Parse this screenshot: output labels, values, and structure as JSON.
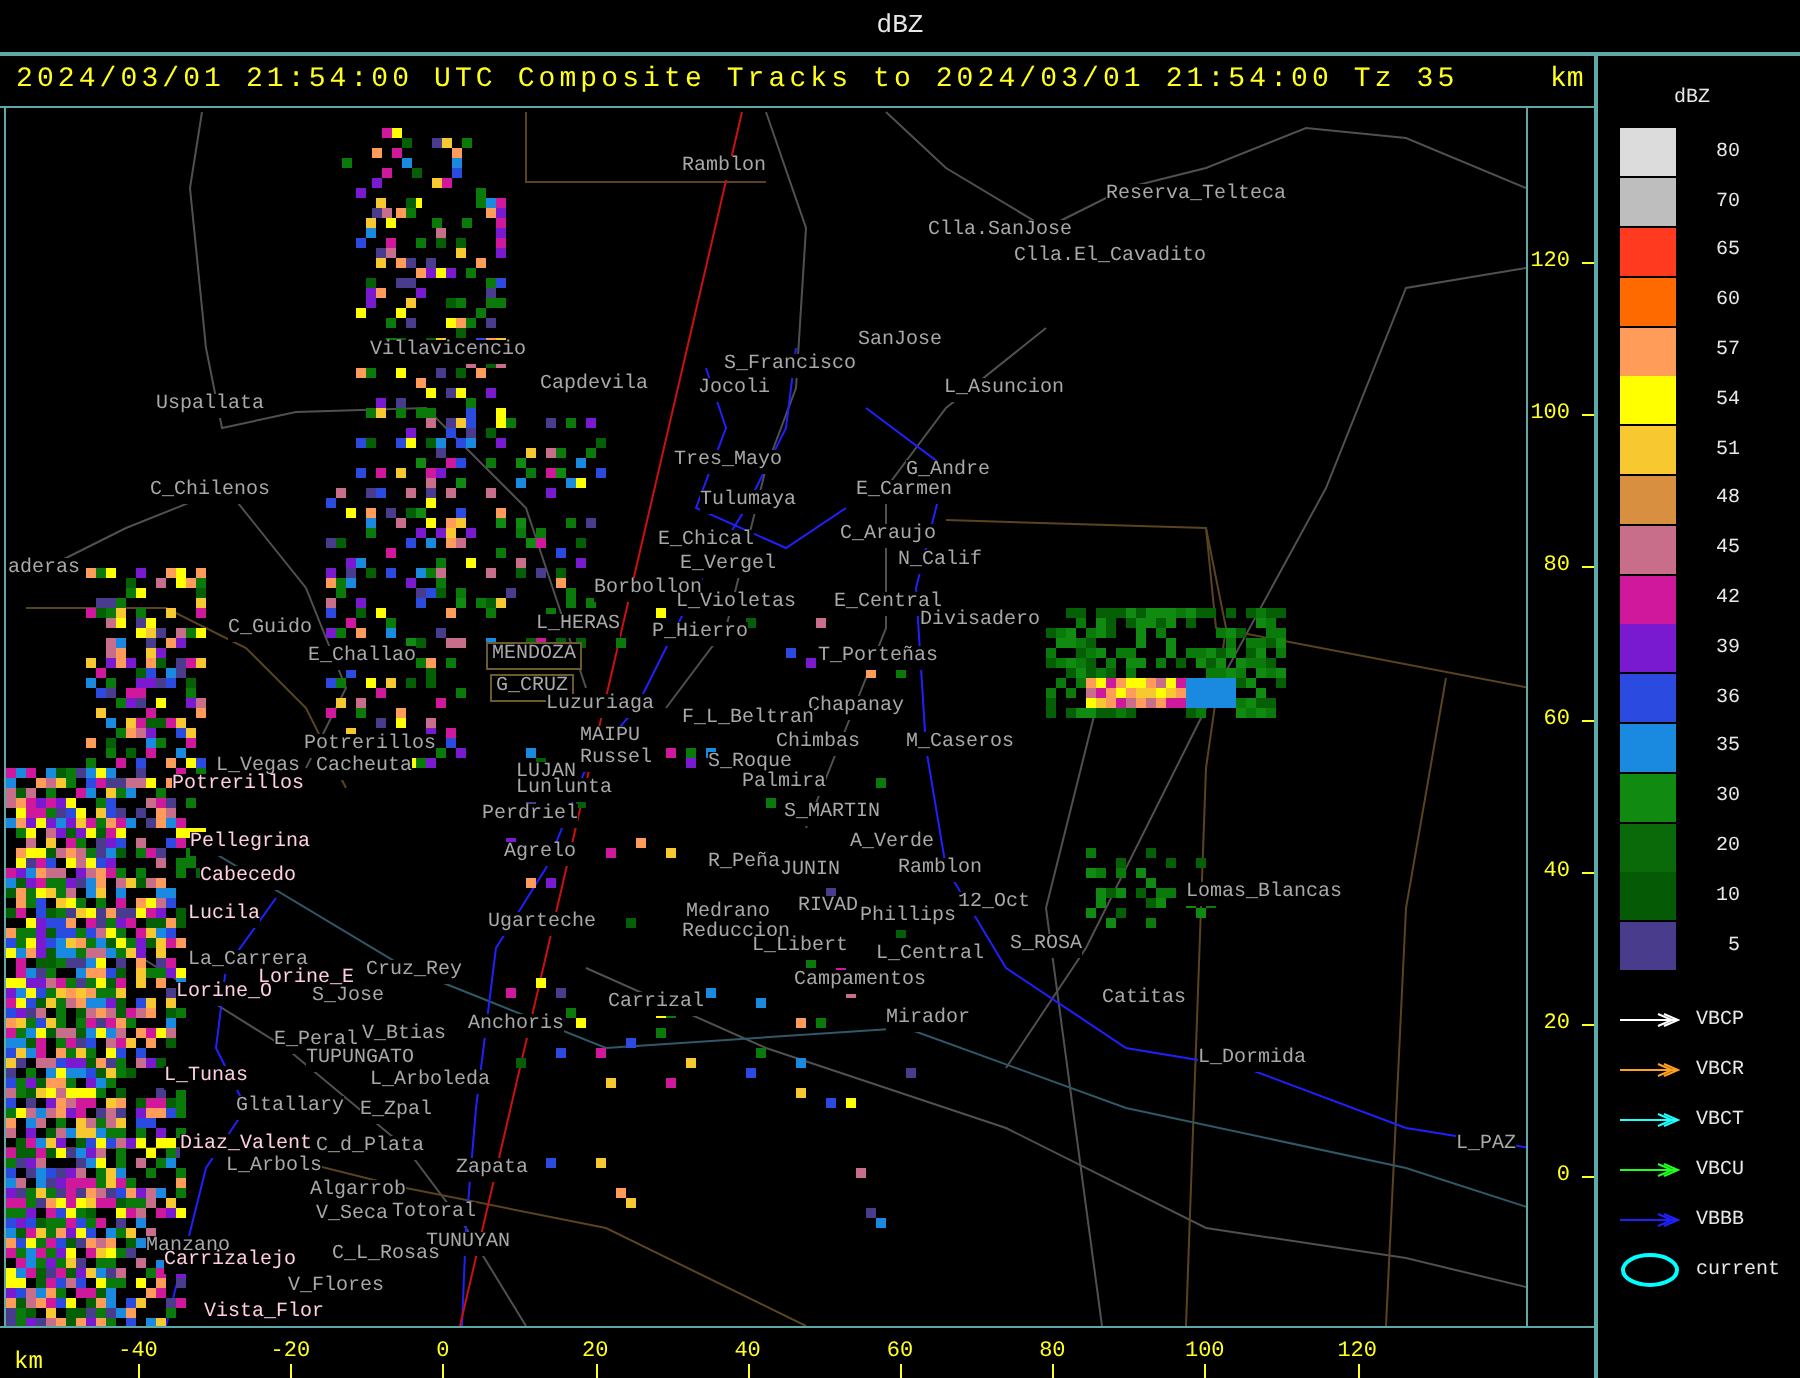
{
  "title_bar": {
    "title": "dBZ"
  },
  "header": {
    "caption": "2024/03/01 21:54:00 UTC Composite Tracks to 2024/03/01 21:54:00 Tz 35",
    "unit": "km"
  },
  "map": {
    "places": [
      {
        "name": "Ramblon",
        "color": "#a8a8a8",
        "kind": "plain"
      },
      {
        "name": "Reserva_Telteca",
        "color": "#a8a8a8",
        "kind": "plain"
      },
      {
        "name": "Clla.SanJose",
        "color": "#a8a8a8",
        "kind": "plain"
      },
      {
        "name": "Clla.El_Cavadito",
        "color": "#a8a8a8",
        "kind": "plain"
      },
      {
        "name": "SanJose",
        "color": "#a8a8a8",
        "kind": "plain"
      },
      {
        "name": "Villavicencio",
        "color": "#a8a8a8",
        "kind": "plain"
      },
      {
        "name": "S_Francisco",
        "color": "#a8a8a8",
        "kind": "plain"
      },
      {
        "name": "Capdevila",
        "color": "#a8a8a8",
        "kind": "plain"
      },
      {
        "name": "Jocoli",
        "color": "#a8a8a8",
        "kind": "plain"
      },
      {
        "name": "L_Asuncion",
        "color": "#a8a8a8",
        "kind": "plain"
      },
      {
        "name": "Uspallata",
        "color": "#a8a8a8",
        "kind": "plain"
      },
      {
        "name": "Tres_Mayo",
        "color": "#a8a8a8",
        "kind": "plain"
      },
      {
        "name": "G_Andre",
        "color": "#a8a8a8",
        "kind": "plain"
      },
      {
        "name": "C_Chilenos",
        "color": "#a8a8a8",
        "kind": "plain"
      },
      {
        "name": "E_Carmen",
        "color": "#a8a8a8",
        "kind": "plain"
      },
      {
        "name": "Tulumaya",
        "color": "#a8a8a8",
        "kind": "plain"
      },
      {
        "name": "E_Chical",
        "color": "#a8a8a8",
        "kind": "plain"
      },
      {
        "name": "C_Araujo",
        "color": "#a8a8a8",
        "kind": "plain"
      },
      {
        "name": "E_Vergel",
        "color": "#a8a8a8",
        "kind": "plain"
      },
      {
        "name": "N_Calif",
        "color": "#a8a8a8",
        "kind": "plain"
      },
      {
        "name": "aderas",
        "color": "#a8a8a8",
        "kind": "plain"
      },
      {
        "name": "Borbollon",
        "color": "#a8a8a8",
        "kind": "plain"
      },
      {
        "name": "L_Violetas",
        "color": "#a8a8a8",
        "kind": "plain"
      },
      {
        "name": "E_Central",
        "color": "#a8a8a8",
        "kind": "plain"
      },
      {
        "name": "C_Guido",
        "color": "#a8a8a8",
        "kind": "plain"
      },
      {
        "name": "L_HERAS",
        "color": "#a8a8a8",
        "kind": "plain"
      },
      {
        "name": "P_Hierro",
        "color": "#a8a8a8",
        "kind": "plain"
      },
      {
        "name": "Divisadero",
        "color": "#a8a8a8",
        "kind": "plain"
      },
      {
        "name": "E_Challao",
        "color": "#a8a8a8",
        "kind": "plain"
      },
      {
        "name": "MENDOZA",
        "color": "#a8a8a8",
        "kind": "boxed"
      },
      {
        "name": "T_Porteñas",
        "color": "#a8a8a8",
        "kind": "plain"
      },
      {
        "name": "G_CRUZ",
        "color": "#a8a8a8",
        "kind": "boxed"
      },
      {
        "name": "Luzuriaga",
        "color": "#a8a8a8",
        "kind": "plain"
      },
      {
        "name": "Chapanay",
        "color": "#a8a8a8",
        "kind": "plain"
      },
      {
        "name": "F_L_Beltran",
        "color": "#a8a8a8",
        "kind": "plain"
      },
      {
        "name": "Potrerillos",
        "color": "#a8a8a8",
        "kind": "plain"
      },
      {
        "name": "MAIPU",
        "color": "#a8a8a8",
        "kind": "plain"
      },
      {
        "name": "Chimbas",
        "color": "#a8a8a8",
        "kind": "plain"
      },
      {
        "name": "M_Caseros",
        "color": "#a8a8a8",
        "kind": "plain"
      },
      {
        "name": "L_Vegas",
        "color": "#a8a8a8",
        "kind": "plain"
      },
      {
        "name": "Cacheuta",
        "color": "#a8a8a8",
        "kind": "plain"
      },
      {
        "name": "Russel",
        "color": "#a8a8a8",
        "kind": "plain"
      },
      {
        "name": "S_Roque",
        "color": "#a8a8a8",
        "kind": "plain"
      },
      {
        "name": "LUJAN",
        "color": "#a8a8a8",
        "kind": "plain"
      },
      {
        "name": "Potrerillos",
        "color": "#ffd0e0",
        "kind": "plain"
      },
      {
        "name": "Lunlunta",
        "color": "#a8a8a8",
        "kind": "plain"
      },
      {
        "name": "Palmira",
        "color": "#a8a8a8",
        "kind": "plain"
      },
      {
        "name": "Perdriel",
        "color": "#a8a8a8",
        "kind": "plain"
      },
      {
        "name": "S_MARTIN",
        "color": "#a8a8a8",
        "kind": "plain"
      },
      {
        "name": "Pellegrina",
        "color": "#ffd0e0",
        "kind": "plain"
      },
      {
        "name": "A_Verde",
        "color": "#a8a8a8",
        "kind": "plain"
      },
      {
        "name": "Agrelo",
        "color": "#a8a8a8",
        "kind": "plain"
      },
      {
        "name": "Cabecedo",
        "color": "#ffd0e0",
        "kind": "plain"
      },
      {
        "name": "R_Peña",
        "color": "#a8a8a8",
        "kind": "plain"
      },
      {
        "name": "JUNIN",
        "color": "#a8a8a8",
        "kind": "plain"
      },
      {
        "name": "Ramblon",
        "color": "#a8a8a8",
        "kind": "plain"
      },
      {
        "name": "Lomas_Blancas",
        "color": "#a8a8a8",
        "kind": "plain"
      },
      {
        "name": "Lucila",
        "color": "#ffd0e0",
        "kind": "plain"
      },
      {
        "name": "RIVAD",
        "color": "#a8a8a8",
        "kind": "plain"
      },
      {
        "name": "12_Oct",
        "color": "#a8a8a8",
        "kind": "plain"
      },
      {
        "name": "Medrano",
        "color": "#a8a8a8",
        "kind": "plain"
      },
      {
        "name": "Ugarteche",
        "color": "#a8a8a8",
        "kind": "plain"
      },
      {
        "name": "Phillips",
        "color": "#a8a8a8",
        "kind": "plain"
      },
      {
        "name": "Reduccion",
        "color": "#a8a8a8",
        "kind": "plain"
      },
      {
        "name": "L_Libert",
        "color": "#a8a8a8",
        "kind": "plain"
      },
      {
        "name": "S_ROSA",
        "color": "#a8a8a8",
        "kind": "plain"
      },
      {
        "name": "La_Carrera",
        "color": "#a8a8a8",
        "kind": "plain"
      },
      {
        "name": "L_Central",
        "color": "#a8a8a8",
        "kind": "plain"
      },
      {
        "name": "Cruz_Rey",
        "color": "#a8a8a8",
        "kind": "plain"
      },
      {
        "name": "Lorine_E",
        "color": "#ffd0e0",
        "kind": "plain"
      },
      {
        "name": "Campamentos",
        "color": "#a8a8a8",
        "kind": "plain"
      },
      {
        "name": "Lorine_O",
        "color": "#ffd0e0",
        "kind": "plain"
      },
      {
        "name": "S_Jose",
        "color": "#a8a8a8",
        "kind": "plain"
      },
      {
        "name": "Carrizal",
        "color": "#a8a8a8",
        "kind": "plain"
      },
      {
        "name": "Catitas",
        "color": "#a8a8a8",
        "kind": "plain"
      },
      {
        "name": "Anchoris",
        "color": "#a8a8a8",
        "kind": "plain"
      },
      {
        "name": "Mirador",
        "color": "#a8a8a8",
        "kind": "plain"
      },
      {
        "name": "E_Peral",
        "color": "#a8a8a8",
        "kind": "plain"
      },
      {
        "name": "V_Btias",
        "color": "#a8a8a8",
        "kind": "plain"
      },
      {
        "name": "TUPUNGATO",
        "color": "#a8a8a8",
        "kind": "plain"
      },
      {
        "name": "L_Dormida",
        "color": "#a8a8a8",
        "kind": "plain"
      },
      {
        "name": "L_Tunas",
        "color": "#ffd0e0",
        "kind": "plain"
      },
      {
        "name": "L_Arboleda",
        "color": "#a8a8a8",
        "kind": "plain"
      },
      {
        "name": "Gltallary",
        "color": "#a8a8a8",
        "kind": "plain"
      },
      {
        "name": "E_Zpal",
        "color": "#a8a8a8",
        "kind": "plain"
      },
      {
        "name": "Diaz_Valent",
        "color": "#ffd0e0",
        "kind": "plain"
      },
      {
        "name": "C_d_Plata",
        "color": "#a8a8a8",
        "kind": "plain"
      },
      {
        "name": "L_PAZ",
        "color": "#a8a8a8",
        "kind": "plain"
      },
      {
        "name": "L_Arbols",
        "color": "#a8a8a8",
        "kind": "plain"
      },
      {
        "name": "Zapata",
        "color": "#a8a8a8",
        "kind": "plain"
      },
      {
        "name": "Algarrob",
        "color": "#a8a8a8",
        "kind": "plain"
      },
      {
        "name": "V_Seca",
        "color": "#a8a8a8",
        "kind": "plain"
      },
      {
        "name": "Totoral",
        "color": "#a8a8a8",
        "kind": "plain"
      },
      {
        "name": "Manzano",
        "color": "#a8a8a8",
        "kind": "plain"
      },
      {
        "name": "TUNUYAN",
        "color": "#a8a8a8",
        "kind": "plain"
      },
      {
        "name": "Carrizalejo",
        "color": "#ffd0e0",
        "kind": "plain"
      },
      {
        "name": "C_L_Rosas",
        "color": "#a8a8a8",
        "kind": "plain"
      },
      {
        "name": "V_Flores",
        "color": "#a8a8a8",
        "kind": "plain"
      },
      {
        "name": "Vista_Flor",
        "color": "#ffd0e0",
        "kind": "plain"
      }
    ]
  },
  "y_axis": {
    "ticks": [
      "120",
      "100",
      "80",
      "60",
      "40",
      "20",
      "0"
    ]
  },
  "x_axis": {
    "unit": "km",
    "ticks": [
      "-40",
      "-20",
      "0",
      "20",
      "40",
      "60",
      "80",
      "100",
      "120"
    ]
  },
  "legend": {
    "title": "dBZ",
    "scale": [
      {
        "value": "80",
        "color": "#dcdcdc"
      },
      {
        "value": "70",
        "color": "#bebebe"
      },
      {
        "value": "65",
        "color": "#ff3a1e"
      },
      {
        "value": "60",
        "color": "#ff6a00"
      },
      {
        "value": "57",
        "color": "#ff9c5a"
      },
      {
        "value": "54",
        "color": "#ffff00"
      },
      {
        "value": "51",
        "color": "#f8c830"
      },
      {
        "value": "48",
        "color": "#d89040"
      },
      {
        "value": "45",
        "color": "#c86e8a"
      },
      {
        "value": "42",
        "color": "#d0189c"
      },
      {
        "value": "39",
        "color": "#7a1ad0"
      },
      {
        "value": "36",
        "color": "#2a4ae0"
      },
      {
        "value": "35",
        "color": "#1a8ae0"
      },
      {
        "value": "30",
        "color": "#108a10"
      },
      {
        "value": "20",
        "color": "#0a6a0a"
      },
      {
        "value": "10",
        "color": "#055a05"
      },
      {
        "value": "5",
        "color": "#4a3c8c"
      }
    ],
    "tracks": [
      {
        "label": "VBCP",
        "color": "#ffffff",
        "kind": "arrow"
      },
      {
        "label": "VBCR",
        "color": "#ffa020",
        "kind": "arrow"
      },
      {
        "label": "VBCT",
        "color": "#20ffff",
        "kind": "arrow"
      },
      {
        "label": "VBCU",
        "color": "#20ff20",
        "kind": "arrow"
      },
      {
        "label": "VBBB",
        "color": "#2020ff",
        "kind": "arrow"
      },
      {
        "label": "current",
        "color": "#00ffff",
        "kind": "ellipse"
      }
    ]
  }
}
